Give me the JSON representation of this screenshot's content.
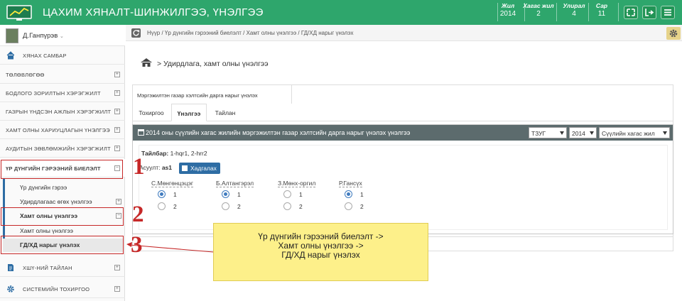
{
  "header": {
    "title": "ЦАХИМ ХЯНАЛТ-ШИНЖИЛГЭЭ, ҮНЭЛГЭЭ",
    "stats": [
      {
        "label": "Жил",
        "value": "2014"
      },
      {
        "label": "Хагас жил",
        "value": "2"
      },
      {
        "label": "Улирал",
        "value": "4"
      },
      {
        "label": "Сар",
        "value": "11"
      }
    ]
  },
  "sidebar": {
    "user": "Д.Ганпүрэв",
    "items": [
      {
        "label": "ХЯНАХ САМБАР",
        "icon": "dashboard-icon"
      },
      {
        "label": "ТӨЛӨВЛӨГӨӨ"
      },
      {
        "label": "БОДЛОГО ЗОРИЛТЫН ХЭРЭГЖИЛТ"
      },
      {
        "label": "ГАЗРЫН ҮНДСЭН АЖЛЫН ХЭРЭГЖИЛТ"
      },
      {
        "label": "ХАМТ ОЛНЫ ХАРИУЦЛАГЫН ҮНЭЛГЭЭ"
      },
      {
        "label": "АУДИТЫН ЗӨВЛӨМЖИЙН ХЭРЭГЖИЛТ"
      },
      {
        "label": "ҮР ДҮНГИЙН ГЭРЭЭНИЙ БИЕЛЭЛТ"
      }
    ],
    "subitems": [
      {
        "label": "Үр дүнгийн гэрээ"
      },
      {
        "label": "Удирдлагаас өгөх үнэлгээ"
      },
      {
        "label": "Хамт олны үнэлгээ"
      },
      {
        "label": "Хамт олны үнэлгээ"
      },
      {
        "label": "ГД/ХД нарыг үнэлэх"
      }
    ],
    "bottom": [
      {
        "label": "ХШҮ-НИЙ ТАЙЛАН",
        "icon": "report-icon"
      },
      {
        "label": "СИСТЕМИЙН ТОХИРГОО",
        "icon": "gear-icon"
      }
    ]
  },
  "breadcrumb": "Нүүр  /  Үр дүнгийн гэрээний биелэлт  /  Хамт олны үнэлгээ  /  ГД/ХД нарыг үнэлэх",
  "page_title": "> Удирдлага, хамт олны үнэлгээ",
  "main_tab": "Мэргэжилтэн газар хэлтсийн дарга нарыг үнэлэх",
  "sub_tabs": [
    "Тохиргоо",
    "Үнэлгээ",
    "Тайлан"
  ],
  "panel": {
    "title": "2014 оны сүүлийн хагас жилийн мэргэжилтэн газар хэлтсийн дарга нарыг үнэлэх үнэлгээ",
    "selects": [
      "ТЗУГ",
      "2014",
      "Сүүлийн хагас жил"
    ],
    "note_label": "Тайлбар:",
    "note_value": " 1-hqr1, 2-hrr2",
    "score_label": "Асуулт: ",
    "score_value": "as1",
    "save_button": "Хадгалах",
    "people": [
      "С.Мөнгөнцэцэг",
      "Б.Алтангэрэл",
      "З.Мөнх-оргил",
      "Р.Гансүх"
    ],
    "options": [
      "1",
      "2"
    ]
  },
  "callout": {
    "line1": "Үр дүнгийн гэрээний биелэлт ->",
    "line2": "Хамт олны үнэлгээ ->",
    "line3": "ГД/ХД нарыг үнэлэх"
  },
  "annotations": [
    "1",
    "2",
    "3"
  ],
  "colors": {
    "brand": "#2ea66c",
    "panel_header": "#5c6b6d",
    "accent": "#2e6da4",
    "annotation": "#c62828",
    "callout": "#fdf08a"
  }
}
